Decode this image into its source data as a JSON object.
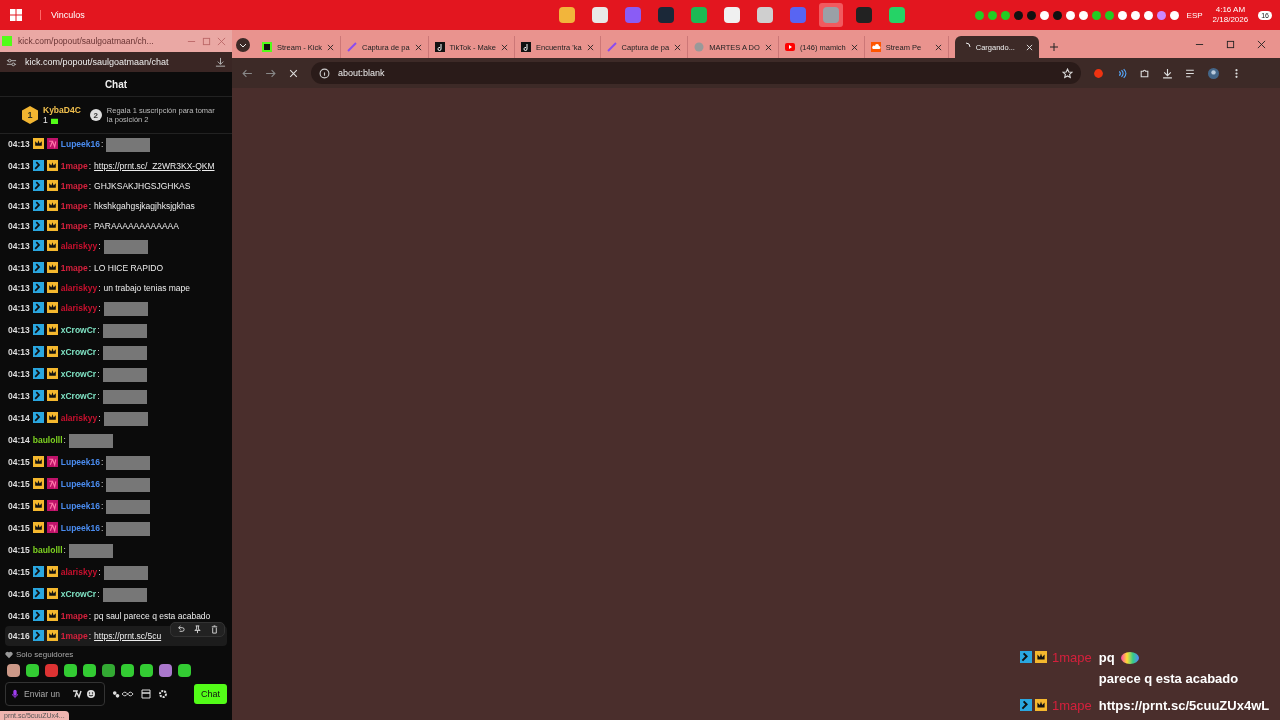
{
  "taskbar": {
    "toolbar_label": "Vinculos",
    "language": "ESP",
    "time": "4:16 AM",
    "date": "2/18/2026",
    "notification_count": "16"
  },
  "chat_window": {
    "title": "kick.com/popout/saulgoatmaan/ch...",
    "url": "kick.com/popout/saulgoatmaan/chat",
    "header": "Chat",
    "leaderboard": {
      "rank": "1",
      "user": "KybaD4C",
      "count": "1",
      "next_rank": "2",
      "hint": "Regala 1 suscripción para tomar la posición 2"
    },
    "messages": [
      {
        "time": "04:13",
        "badges": [
          {
            "kind": "crown"
          },
          {
            "kind": "tag"
          }
        ],
        "user": "Lupeek16",
        "separator": ":",
        "color": "#4a8cf0",
        "kind": "image",
        "hovered": false
      },
      {
        "time": "04:13",
        "badges": [
          {
            "kind": "mod"
          },
          {
            "kind": "crown"
          }
        ],
        "user": "1mape",
        "separator": ":",
        "color": "#d4203c",
        "kind": "link",
        "text": "https://prnt.sc/_Z2WR3KX-QKM",
        "hovered": false
      },
      {
        "time": "04:13",
        "badges": [
          {
            "kind": "mod"
          },
          {
            "kind": "crown"
          }
        ],
        "user": "1mape",
        "separator": ":",
        "color": "#d4203c",
        "kind": "text",
        "text": "GHJKSAKJHGSJGHKAS",
        "hovered": false
      },
      {
        "time": "04:13",
        "badges": [
          {
            "kind": "mod"
          },
          {
            "kind": "crown"
          }
        ],
        "user": "1mape",
        "separator": ":",
        "color": "#d4203c",
        "kind": "text",
        "text": "hkshkgahgsjkagjhksjgkhas",
        "hovered": false
      },
      {
        "time": "04:13",
        "badges": [
          {
            "kind": "mod"
          },
          {
            "kind": "crown"
          }
        ],
        "user": "1mape",
        "separator": ":",
        "color": "#d4203c",
        "kind": "text",
        "text": "PARAAAAAAAAAAAA",
        "hovered": false
      },
      {
        "time": "04:13",
        "badges": [
          {
            "kind": "mod"
          },
          {
            "kind": "crown"
          }
        ],
        "user": "alariskyy",
        "separator": ":",
        "color": "#c8102e",
        "kind": "image",
        "hovered": false
      },
      {
        "time": "04:13",
        "badges": [
          {
            "kind": "mod"
          },
          {
            "kind": "crown"
          }
        ],
        "user": "1mape",
        "separator": ":",
        "color": "#d4203c",
        "kind": "text",
        "text": "LO HICE RAPIDO",
        "hovered": false
      },
      {
        "time": "04:13",
        "badges": [
          {
            "kind": "mod"
          },
          {
            "kind": "crown"
          }
        ],
        "user": "alariskyy",
        "separator": ":",
        "color": "#c8102e",
        "kind": "text",
        "text": "un trabajo tenias mape",
        "hovered": false
      },
      {
        "time": "04:13",
        "badges": [
          {
            "kind": "mod"
          },
          {
            "kind": "crown"
          }
        ],
        "user": "alariskyy",
        "separator": ":",
        "color": "#c8102e",
        "kind": "image",
        "hovered": false
      },
      {
        "time": "04:13",
        "badges": [
          {
            "kind": "mod"
          },
          {
            "kind": "crown"
          }
        ],
        "user": "xCrowCr",
        "separator": ":",
        "color": "#7fe3c4",
        "kind": "image",
        "hovered": false
      },
      {
        "time": "04:13",
        "badges": [
          {
            "kind": "mod"
          },
          {
            "kind": "crown"
          }
        ],
        "user": "xCrowCr",
        "separator": ":",
        "color": "#7fe3c4",
        "kind": "image",
        "hovered": false
      },
      {
        "time": "04:13",
        "badges": [
          {
            "kind": "mod"
          },
          {
            "kind": "crown"
          }
        ],
        "user": "xCrowCr",
        "separator": ":",
        "color": "#7fe3c4",
        "kind": "image",
        "hovered": false
      },
      {
        "time": "04:13",
        "badges": [
          {
            "kind": "mod"
          },
          {
            "kind": "crown"
          }
        ],
        "user": "xCrowCr",
        "separator": ":",
        "color": "#7fe3c4",
        "kind": "image",
        "hovered": false
      },
      {
        "time": "04:14",
        "badges": [
          {
            "kind": "mod"
          },
          {
            "kind": "crown"
          }
        ],
        "user": "alariskyy",
        "separator": ":",
        "color": "#c8102e",
        "kind": "image",
        "hovered": false
      },
      {
        "time": "04:14",
        "user": "baulolll",
        "separator": ":",
        "color": "#7ed321",
        "kind": "image",
        "hovered": false
      },
      {
        "time": "04:15",
        "badges": [
          {
            "kind": "crown"
          },
          {
            "kind": "tag"
          }
        ],
        "user": "Lupeek16",
        "separator": ":",
        "color": "#4a8cf0",
        "kind": "image",
        "hovered": false
      },
      {
        "time": "04:15",
        "badges": [
          {
            "kind": "crown"
          },
          {
            "kind": "tag"
          }
        ],
        "user": "Lupeek16",
        "separator": ":",
        "color": "#4a8cf0",
        "kind": "image",
        "hovered": false
      },
      {
        "time": "04:15",
        "badges": [
          {
            "kind": "crown"
          },
          {
            "kind": "tag"
          }
        ],
        "user": "Lupeek16",
        "separator": ":",
        "color": "#4a8cf0",
        "kind": "image",
        "hovered": false
      },
      {
        "time": "04:15",
        "badges": [
          {
            "kind": "crown"
          },
          {
            "kind": "tag"
          }
        ],
        "user": "Lupeek16",
        "separator": ":",
        "color": "#4a8cf0",
        "kind": "image",
        "hovered": false
      },
      {
        "time": "04:15",
        "user": "baulolll",
        "separator": ":",
        "color": "#7ed321",
        "kind": "image",
        "hovered": false
      },
      {
        "time": "04:15",
        "badges": [
          {
            "kind": "mod"
          },
          {
            "kind": "crown"
          }
        ],
        "user": "alariskyy",
        "separator": ":",
        "color": "#c8102e",
        "kind": "image",
        "hovered": false
      },
      {
        "time": "04:16",
        "badges": [
          {
            "kind": "mod"
          },
          {
            "kind": "crown"
          }
        ],
        "user": "xCrowCr",
        "separator": ":",
        "color": "#7fe3c4",
        "kind": "image",
        "hovered": false
      },
      {
        "time": "04:16",
        "badges": [
          {
            "kind": "mod"
          },
          {
            "kind": "crown"
          }
        ],
        "user": "1mape",
        "separator": ":",
        "color": "#d4203c",
        "kind": "text",
        "text": "pq saul parece q esta acabado",
        "hovered": false
      },
      {
        "time": "04:16",
        "badges": [
          {
            "kind": "mod"
          },
          {
            "kind": "crown"
          }
        ],
        "user": "1mape",
        "separator": ":",
        "color": "#d4203c",
        "kind": "link",
        "text": "https://prnt.sc/5cu",
        "hovered": true
      }
    ],
    "chat_mode": "Solo seguidores",
    "input": {
      "placeholder": "Enviar un"
    },
    "send_button": "Chat",
    "status_url": "prnt.sc/5cuuZUx4..."
  },
  "browser": {
    "tabs": [
      {
        "title": "Stream - Kick",
        "kind": "square",
        "selected": false
      },
      {
        "title": "Captura de pa",
        "kind": "pen",
        "selected": false
      },
      {
        "title": "TikTok - Make",
        "kind": "note",
        "selected": false
      },
      {
        "title": "Encuentra 'ka",
        "kind": "note",
        "selected": false
      },
      {
        "title": "Captura de pa",
        "kind": "pen",
        "selected": false
      },
      {
        "title": "MARTES A DO",
        "kind": "globe",
        "selected": false
      },
      {
        "title": "(146) mamich",
        "kind": "play",
        "selected": false
      },
      {
        "title": "Stream Pe",
        "kind": "cloud",
        "selected": false
      },
      {
        "title": "Cargando...",
        "kind": "spinner",
        "selected": true
      }
    ],
    "address": "about:blank",
    "overlay_messages": [
      {
        "user": "1mape",
        "color": "#d4203c",
        "text_before": "pq",
        "text_after": "parece q esta acabado",
        "has_emote": true
      },
      {
        "user": "1mape",
        "color": "#d4203c",
        "text_before": "https://prnt.sc/5cuuZUx4wL",
        "has_emote": false
      }
    ]
  }
}
